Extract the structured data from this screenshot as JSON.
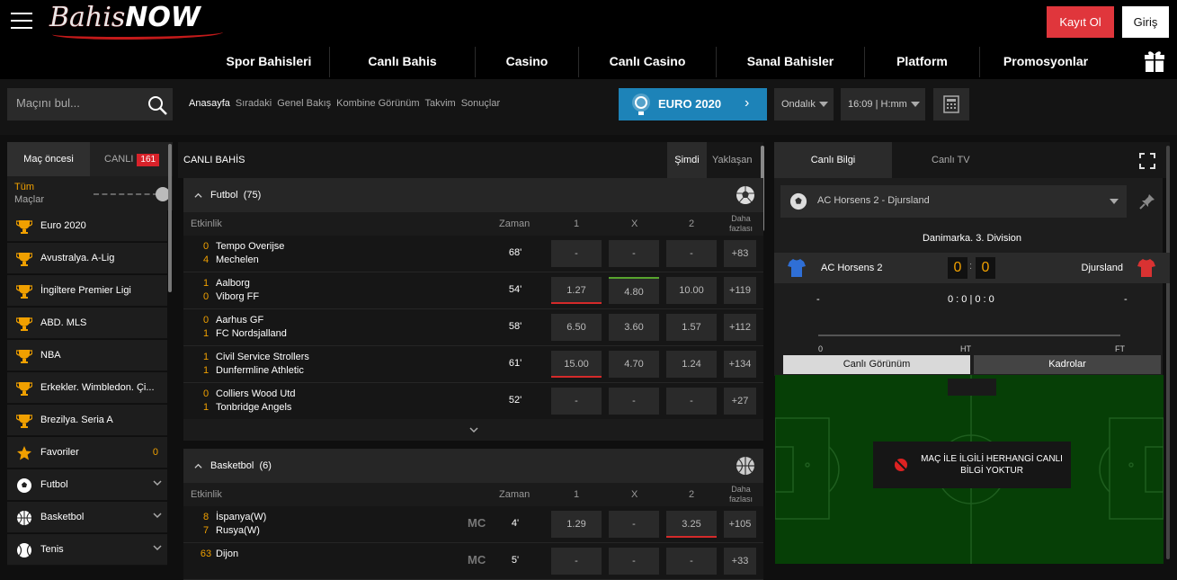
{
  "header": {
    "logo_text_1": "Bahis",
    "logo_text_2": "NOW",
    "register_label": "Kayıt Ol",
    "login_label": "Giriş",
    "nav": [
      "Spor Bahisleri",
      "Canlı Bahis",
      "Casino",
      "Canlı Casino",
      "Sanal Bahisler",
      "Platform",
      "Promosyonlar"
    ]
  },
  "toolbar": {
    "search_placeholder": "Maçını bul...",
    "subnav": [
      "Anasayfa",
      "Sıradaki",
      "Genel Bakış",
      "Kombine Görünüm",
      "Takvim",
      "Sonuçlar"
    ],
    "euro_label": "EURO 2020",
    "odds_format": "Ondalık",
    "time_format": "16:09 | H:mm"
  },
  "left": {
    "tab_prematch": "Maç öncesi",
    "tab_live": "CANLI",
    "live_count": "161",
    "all_label_1": "Tüm",
    "all_label_2": "Maçlar",
    "leagues": [
      {
        "name": "Euro 2020",
        "icon": "trophy-icon"
      },
      {
        "name": "Avustralya. A-Lig",
        "icon": "trophy-icon"
      },
      {
        "name": "İngiltere Premier Ligi",
        "icon": "trophy-icon"
      },
      {
        "name": "ABD. MLS",
        "icon": "trophy-icon"
      },
      {
        "name": "NBA",
        "icon": "trophy-icon"
      },
      {
        "name": "Erkekler. Wimbledon. Çi...",
        "icon": "trophy-icon"
      },
      {
        "name": "Brezilya. Seria A",
        "icon": "trophy-icon"
      },
      {
        "name": "Favoriler",
        "icon": "star-icon",
        "count": "0"
      },
      {
        "name": "Futbol",
        "icon": "football-icon"
      },
      {
        "name": "Basketbol",
        "icon": "basketball-icon"
      },
      {
        "name": "Tenis",
        "icon": "tennis-icon"
      }
    ]
  },
  "center": {
    "title": "CANLI BAHİS",
    "tab_now": "Şimdi",
    "tab_soon": "Yaklaşan",
    "columns": {
      "event": "Etkinlik",
      "time": "Zaman",
      "c1": "1",
      "cx": "X",
      "c2": "2",
      "more": "Daha fazlası"
    },
    "football": {
      "name": "Futbol",
      "count": "(75)",
      "matches": [
        {
          "s1": "0",
          "s2": "4",
          "t1": "Tempo Overijse",
          "t2": "Mechelen",
          "time": "68'",
          "o1": "-",
          "ox": "-",
          "o2": "-",
          "more": "+83"
        },
        {
          "s1": "1",
          "s2": "0",
          "t1": "Aalborg",
          "t2": "Viborg FF",
          "time": "54'",
          "o1": "1.27",
          "ox": "4.80",
          "o2": "10.00",
          "more": "+119"
        },
        {
          "s1": "0",
          "s2": "1",
          "t1": "Aarhus GF",
          "t2": "FC Nordsjalland",
          "time": "58'",
          "o1": "6.50",
          "ox": "3.60",
          "o2": "1.57",
          "more": "+112"
        },
        {
          "s1": "1",
          "s2": "1",
          "t1": "Civil Service Strollers",
          "t2": "Dunfermline Athletic",
          "time": "61'",
          "o1": "15.00",
          "ox": "4.70",
          "o2": "1.24",
          "more": "+134"
        },
        {
          "s1": "0",
          "s2": "1",
          "t1": "Colliers Wood Utd",
          "t2": "Tonbridge Angels",
          "time": "52'",
          "o1": "-",
          "ox": "-",
          "o2": "-",
          "more": "+27"
        }
      ]
    },
    "basketball": {
      "name": "Basketbol",
      "count": "(6)",
      "matches": [
        {
          "s1": "8",
          "s2": "7",
          "t1": "İspanya(W)",
          "t2": "Rusya(W)",
          "mc": "MC",
          "time": "4'",
          "o1": "1.29",
          "ox": "-",
          "o2": "3.25",
          "more": "+105"
        },
        {
          "s1": "63",
          "s2": "",
          "t1": "Dijon",
          "t2": "",
          "mc": "MC",
          "time": "5'",
          "o1": "-",
          "ox": "-",
          "o2": "-",
          "more": "+33"
        }
      ]
    }
  },
  "right": {
    "tab_info": "Canlı Bilgi",
    "tab_tv": "Canlı TV",
    "match_select": "AC Horsens 2 - Djursland",
    "league": "Danimarka. 3. Division",
    "home": "AC Horsens 2",
    "away": "Djursland",
    "home_score": "0",
    "away_score": "0",
    "colon": ":",
    "stat_left": "-",
    "stat_mid": "0 : 0 | 0 : 0",
    "stat_right": "-",
    "tl_start": "0",
    "tl_ht": "HT",
    "tl_ft": "FT",
    "view_live": "Canlı Görünüm",
    "view_lineups": "Kadrolar",
    "no_data": "MAÇ İLE İLGİLİ HERHANGİ CANLI BİLGİ YOKTUR"
  },
  "colors": {
    "accent": "#e0363c",
    "score": "#f0a000",
    "euro": "#1d83b8",
    "pitch": "#063f06"
  }
}
